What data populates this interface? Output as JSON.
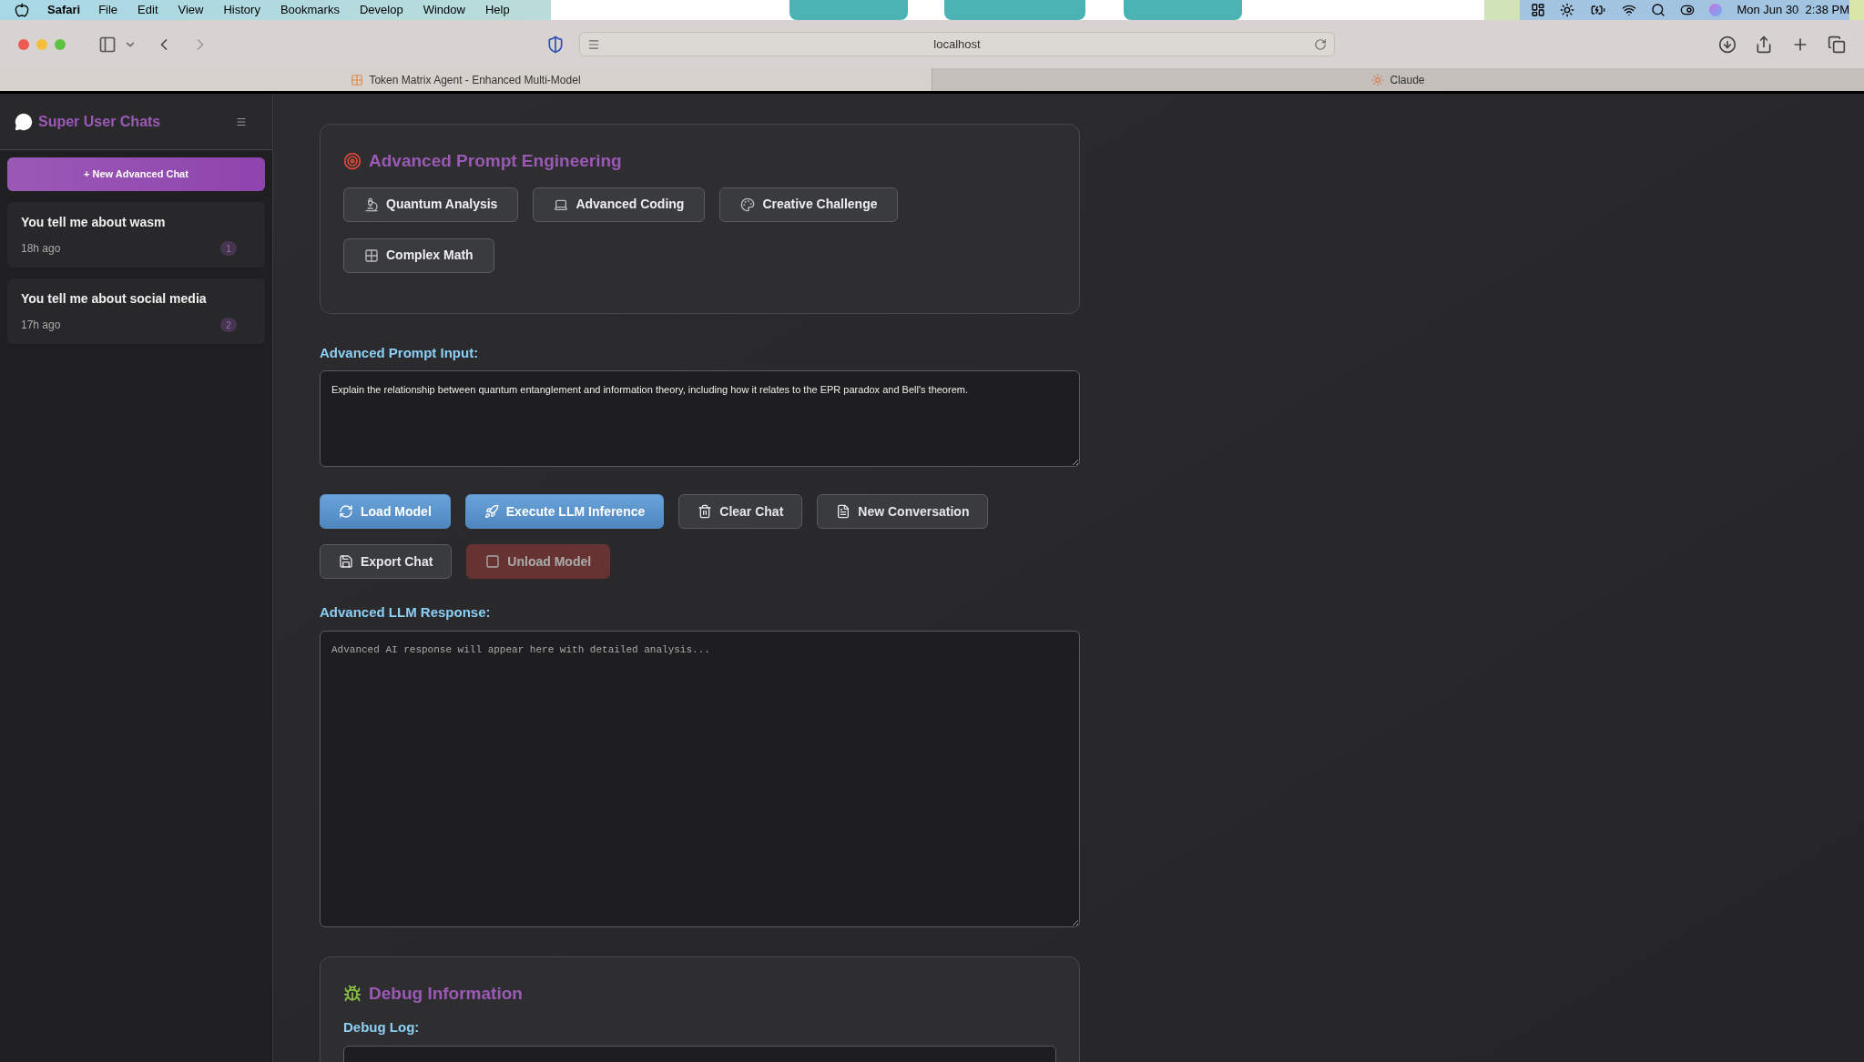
{
  "menu_bar": {
    "app": "Safari",
    "items": [
      "File",
      "Edit",
      "View",
      "History",
      "Bookmarks",
      "Develop",
      "Window",
      "Help"
    ],
    "clock": "Mon Jun 30  2:38 PM"
  },
  "browser": {
    "address": "localhost",
    "tabs": [
      {
        "title": "Token Matrix Agent - Enhanced Multi-Model",
        "selected": true
      },
      {
        "title": "Claude",
        "selected": false
      }
    ]
  },
  "sidebar": {
    "title": "Super User Chats",
    "new_chat_button": "+ New Advanced Chat",
    "chats": [
      {
        "title": "You tell me about wasm",
        "time": "18h ago",
        "count": "1"
      },
      {
        "title": "You tell me about social media",
        "time": "17h ago",
        "count": "2"
      }
    ]
  },
  "prompt_section": {
    "title": "Advanced Prompt Engineering",
    "templates": [
      "Quantum Analysis",
      "Advanced Coding",
      "Creative Challenge",
      "Complex Math"
    ]
  },
  "prompt_input": {
    "label": "Advanced Prompt Input:",
    "value": "Explain the relationship between quantum entanglement and information theory, including how it relates to the EPR paradox and Bell's theorem."
  },
  "actions": [
    {
      "label": "Load Model",
      "kind": "primary",
      "disabled": false
    },
    {
      "label": "Execute LLM Inference",
      "kind": "primary",
      "disabled": false
    },
    {
      "label": "Clear Chat",
      "kind": "secondary",
      "disabled": false
    },
    {
      "label": "New Conversation",
      "kind": "secondary",
      "disabled": false
    },
    {
      "label": "Export Chat",
      "kind": "secondary",
      "disabled": false
    },
    {
      "label": "Unload Model",
      "kind": "danger",
      "disabled": true
    }
  ],
  "response": {
    "label": "Advanced LLM Response:",
    "placeholder": "Advanced AI response will appear here with detailed analysis..."
  },
  "debug": {
    "title": "Debug Information",
    "log_label": "Debug Log:"
  }
}
